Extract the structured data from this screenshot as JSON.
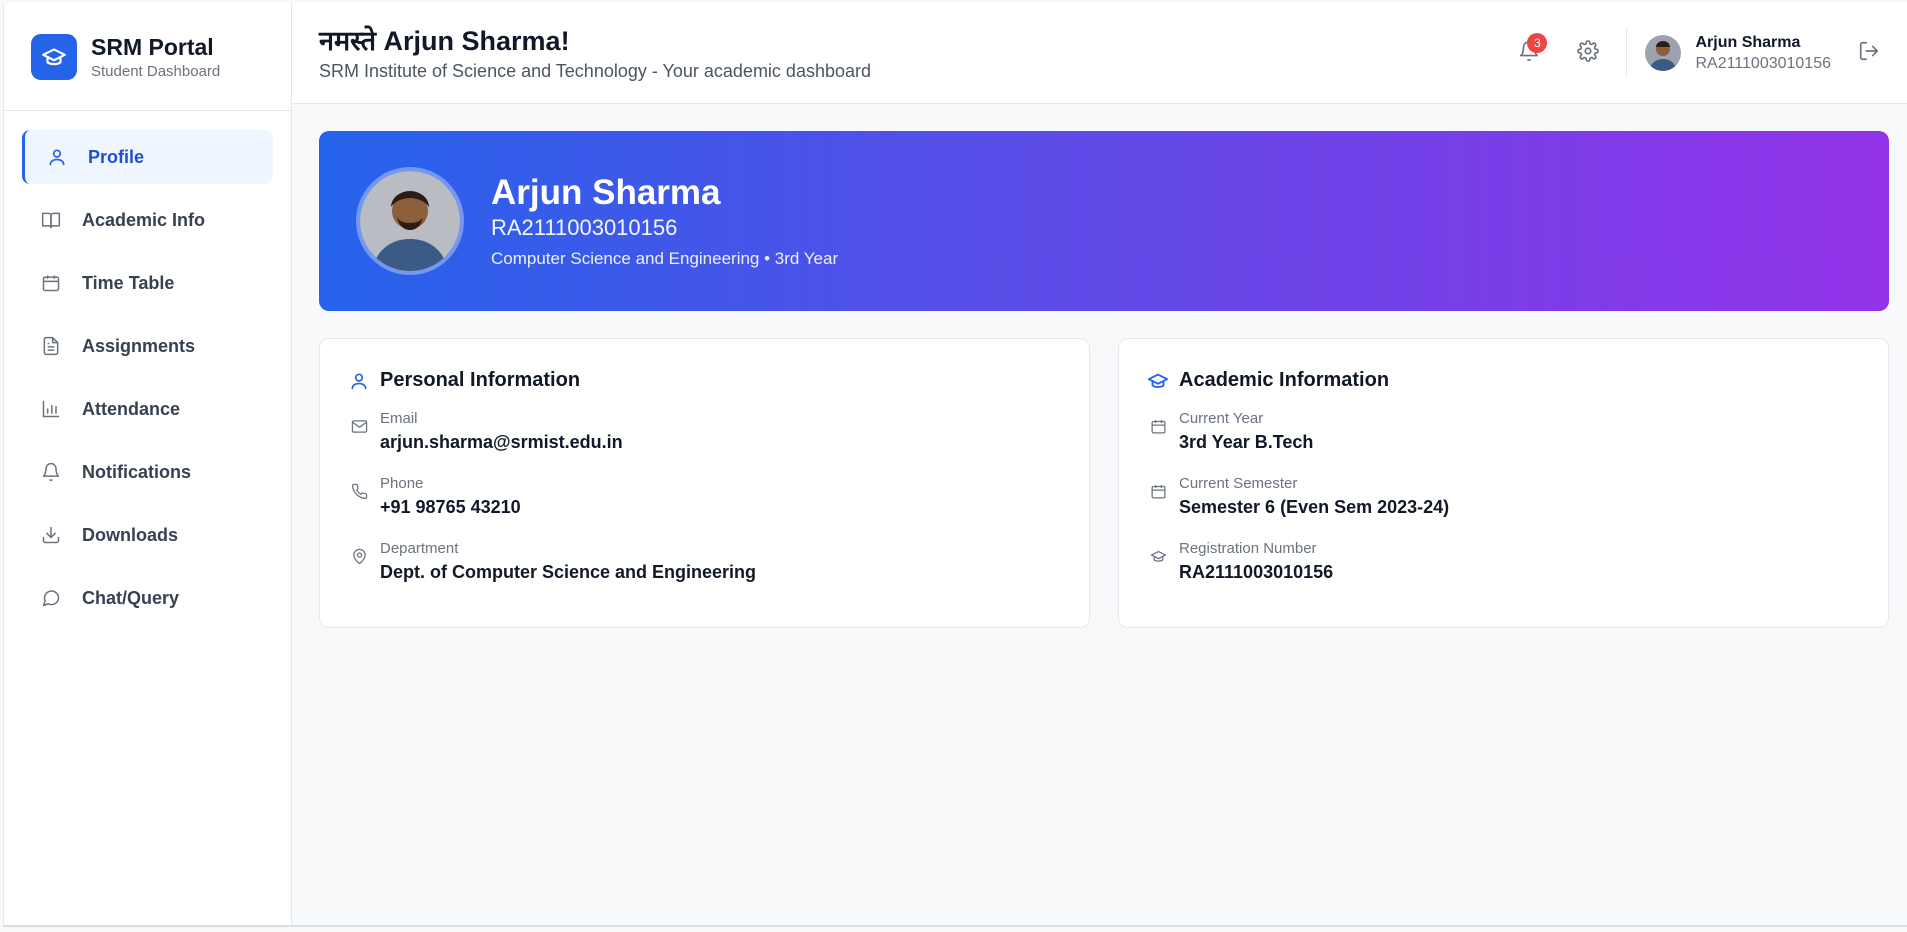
{
  "brand": {
    "title": "SRM Portal",
    "subtitle": "Student Dashboard",
    "icon": "graduation-cap-icon"
  },
  "sidebar": {
    "items": [
      {
        "label": "Profile",
        "icon": "user-icon",
        "active": true
      },
      {
        "label": "Academic Info",
        "icon": "book-open-icon"
      },
      {
        "label": "Time Table",
        "icon": "calendar-icon"
      },
      {
        "label": "Assignments",
        "icon": "file-text-icon"
      },
      {
        "label": "Attendance",
        "icon": "bar-chart-icon"
      },
      {
        "label": "Notifications",
        "icon": "bell-icon"
      },
      {
        "label": "Downloads",
        "icon": "download-icon"
      },
      {
        "label": "Chat/Query",
        "icon": "message-circle-icon"
      }
    ]
  },
  "header": {
    "greeting": "नमस्ते Arjun Sharma!",
    "subtitle": "SRM Institute of Science and Technology - Your academic dashboard",
    "notification_count": "3",
    "user": {
      "name": "Arjun Sharma",
      "id": "RA2111003010156"
    }
  },
  "profile": {
    "name": "Arjun Sharma",
    "reg_no": "RA2111003010156",
    "dept_line": "Computer Science and Engineering • 3rd Year"
  },
  "personal": {
    "title": "Personal Information",
    "fields": [
      {
        "label": "Email",
        "value": "arjun.sharma@srmist.edu.in",
        "icon": "mail-icon"
      },
      {
        "label": "Phone",
        "value": "+91 98765 43210",
        "icon": "phone-icon"
      },
      {
        "label": "Department",
        "value": "Dept. of Computer Science and Engineering",
        "icon": "map-pin-icon"
      }
    ]
  },
  "academic": {
    "title": "Academic Information",
    "fields": [
      {
        "label": "Current Year",
        "value": "3rd Year B.Tech",
        "icon": "calendar-icon"
      },
      {
        "label": "Current Semester",
        "value": "Semester 6 (Even Sem 2023-24)",
        "icon": "calendar-icon"
      },
      {
        "label": "Registration Number",
        "value": "RA2111003010156",
        "icon": "graduation-cap-icon"
      }
    ]
  },
  "colors": {
    "accent": "#2563eb",
    "gradient_start": "#2563eb",
    "gradient_end": "#9333ea",
    "badge": "#ef4444"
  }
}
